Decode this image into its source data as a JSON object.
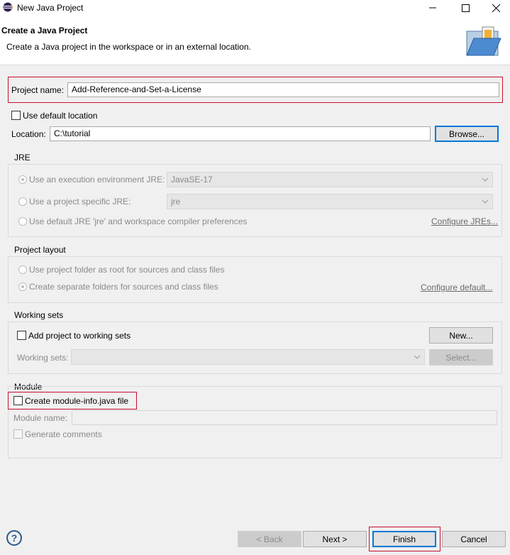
{
  "window": {
    "title": "New Java Project"
  },
  "header": {
    "title": "Create a Java Project",
    "subtitle": "Create a Java project in the workspace or in an external location."
  },
  "project": {
    "name_label": "Project name:",
    "name_value": "Add-Reference-and-Set-a-License",
    "use_default_location_label": "Use default location",
    "use_default_location_checked": false,
    "location_label": "Location:",
    "location_value": "C:\\tutorial",
    "browse_label": "Browse..."
  },
  "jre": {
    "group_label": "JRE",
    "option_execution_env_label": "Use an execution environment JRE:",
    "execution_env_value": "JavaSE-17",
    "option_project_specific_label": "Use a project specific JRE:",
    "project_specific_value": "jre",
    "option_default_label": "Use default JRE 'jre' and workspace compiler preferences",
    "configure_link": "Configure JREs..."
  },
  "layout": {
    "group_label": "Project layout",
    "option_root_label": "Use project folder as root for sources and class files",
    "option_separate_label": "Create separate folders for sources and class files",
    "configure_link": "Configure default..."
  },
  "working_sets": {
    "group_label": "Working sets",
    "add_label": "Add project to working sets",
    "new_button": "New...",
    "sets_label": "Working sets:",
    "select_button": "Select..."
  },
  "module": {
    "group_label": "Module",
    "create_label": "Create module-info.java file",
    "module_name_label": "Module name:",
    "generate_comments_label": "Generate comments"
  },
  "footer": {
    "help_glyph": "?",
    "back_label": "< Back",
    "next_label": "Next >",
    "finish_label": "Finish",
    "cancel_label": "Cancel"
  },
  "colors": {
    "highlight": "#c8102e",
    "focus": "#0078d7"
  }
}
